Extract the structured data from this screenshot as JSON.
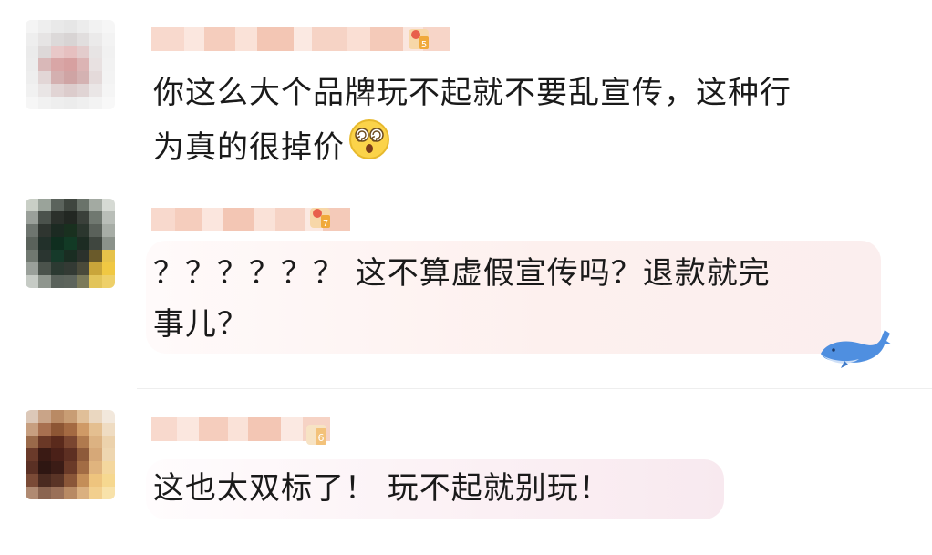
{
  "comments": [
    {
      "text_lines": [
        "你这么大个品牌玩不起就不要乱宣传，这种行",
        "为真的很掉价"
      ],
      "inline_emoji": "dizzy-face-emoji",
      "level": "5",
      "bubble_color": "#ffffff"
    },
    {
      "text_lines": [
        "？？？？？？ 这不算虚假宣传吗？退款就完",
        "事儿？"
      ],
      "level": "7",
      "bubble_color": "#fdf1f0",
      "decoration": "whale-icon"
    },
    {
      "text_lines": [
        "这也太双标了！ 玩不起就别玩！"
      ],
      "level": "6",
      "bubble_color": "#fbf0f4"
    }
  ],
  "colors": {
    "text": "#1a1a1a",
    "nickname_blur": "#f6d2c4",
    "level_badge": "#f0a93a"
  }
}
